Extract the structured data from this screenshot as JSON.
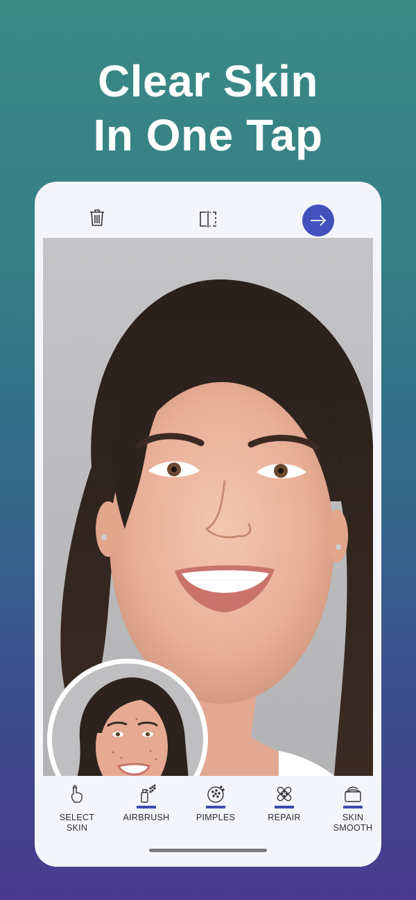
{
  "headline": {
    "line1": "Clear Skin",
    "line2": "In One Tap"
  },
  "topbar": {
    "icons": [
      "trash-icon",
      "compare-icon",
      "arrow-right-icon"
    ]
  },
  "tools": [
    {
      "label": "SELECT\nSKIN",
      "icon": "finger-tap-icon",
      "active": false
    },
    {
      "label": "AIRBRUSH",
      "icon": "airbrush-icon",
      "active": true
    },
    {
      "label": "PIMPLES",
      "icon": "pimples-icon",
      "active": true
    },
    {
      "label": "REPAIR",
      "icon": "bandage-icon",
      "active": true
    },
    {
      "label": "SKIN\nSMOOTH",
      "icon": "cream-jar-icon",
      "active": true
    }
  ],
  "colors": {
    "accent": "#4151be",
    "underline": "#3a4bb3",
    "bg_top": "#3a8a84",
    "bg_bottom": "#4a3a8e"
  }
}
